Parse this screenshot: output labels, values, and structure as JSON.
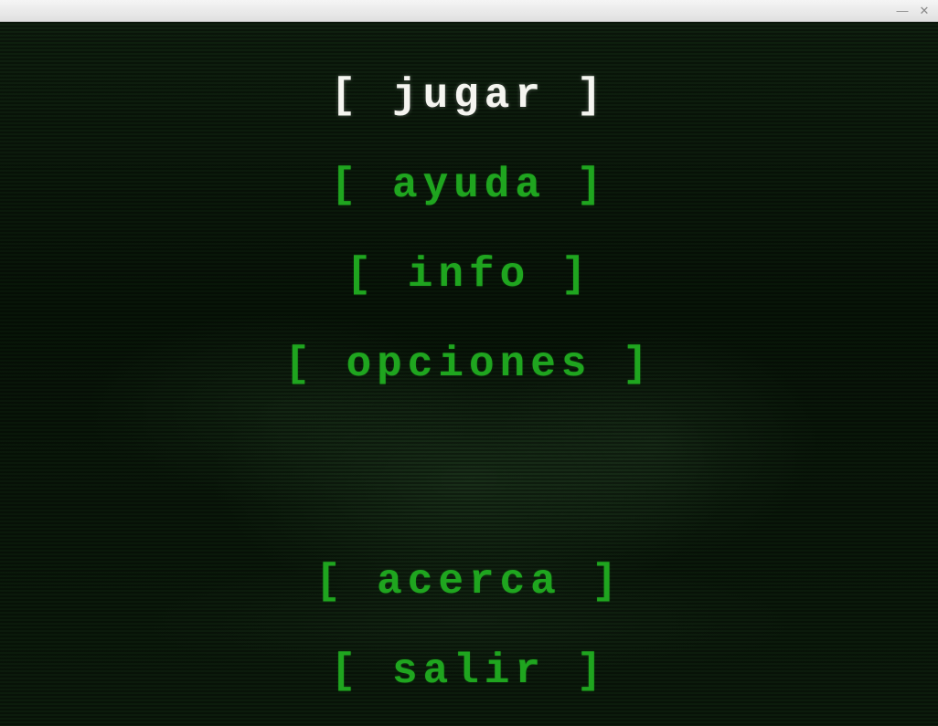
{
  "menu": {
    "items": [
      {
        "label": "[ jugar ]",
        "selected": true
      },
      {
        "label": "[ ayuda ]",
        "selected": false
      },
      {
        "label": "[ info ]",
        "selected": false
      },
      {
        "label": "[ opciones ]",
        "selected": false
      },
      {
        "label": "[ acerca ]",
        "selected": false
      },
      {
        "label": "[ salir ]",
        "selected": false
      }
    ]
  },
  "colors": {
    "menu_normal": "#1fa51f",
    "menu_selected": "#f5f5f0",
    "background": "#0a1a0a"
  }
}
